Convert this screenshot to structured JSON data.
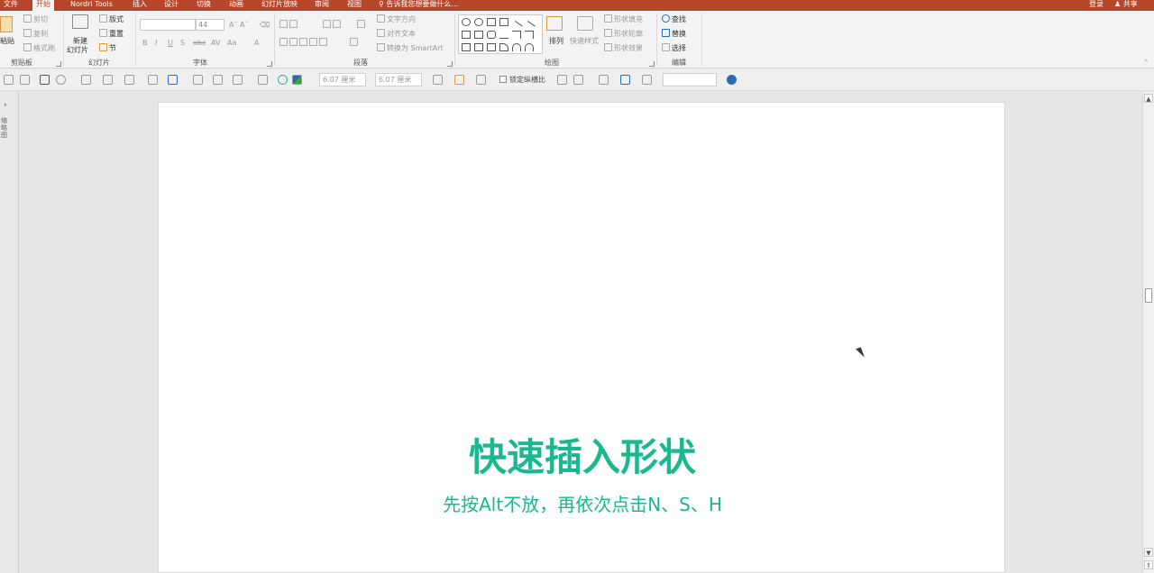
{
  "menubar": {
    "tabs": [
      "文件",
      "开始",
      "Nordri Tools",
      "插入",
      "设计",
      "切换",
      "动画",
      "幻灯片放映",
      "审阅",
      "视图"
    ],
    "active_tab": "开始",
    "tell_me": "告诉我您想要做什么...",
    "login": "登录",
    "share": "共享"
  },
  "ribbon": {
    "clipboard": {
      "label": "剪贴板",
      "paste": "粘贴",
      "cut": "剪切",
      "copy": "复制",
      "format_painter": "格式刷"
    },
    "slides": {
      "label": "幻灯片",
      "new_slide": "新建",
      "new_slide_2": "幻灯片",
      "layout": "版式",
      "reset": "重置",
      "section": "节"
    },
    "font": {
      "label": "字体",
      "size": "44"
    },
    "paragraph": {
      "label": "段落",
      "text_direction": "文字方向",
      "align_text": "对齐文本",
      "smartart": "转换为 SmartArt"
    },
    "drawing": {
      "label": "绘图",
      "arrange": "排列",
      "quick_styles": "快速样式",
      "shape_fill": "形状填充",
      "shape_outline": "形状轮廓",
      "shape_effects": "形状效果"
    },
    "editing": {
      "label": "编辑",
      "find": "查找",
      "replace": "替换",
      "select": "选择"
    }
  },
  "toolbar2": {
    "height_value": "6.07 厘米",
    "width_value": "6.07 厘米",
    "lock_ratio": "锁定纵横比"
  },
  "leftpane": {
    "label": "缩略图"
  },
  "slide": {
    "title": "快速插入形状",
    "subtitle": "先按Alt不放，再依次点击N、S、H"
  }
}
